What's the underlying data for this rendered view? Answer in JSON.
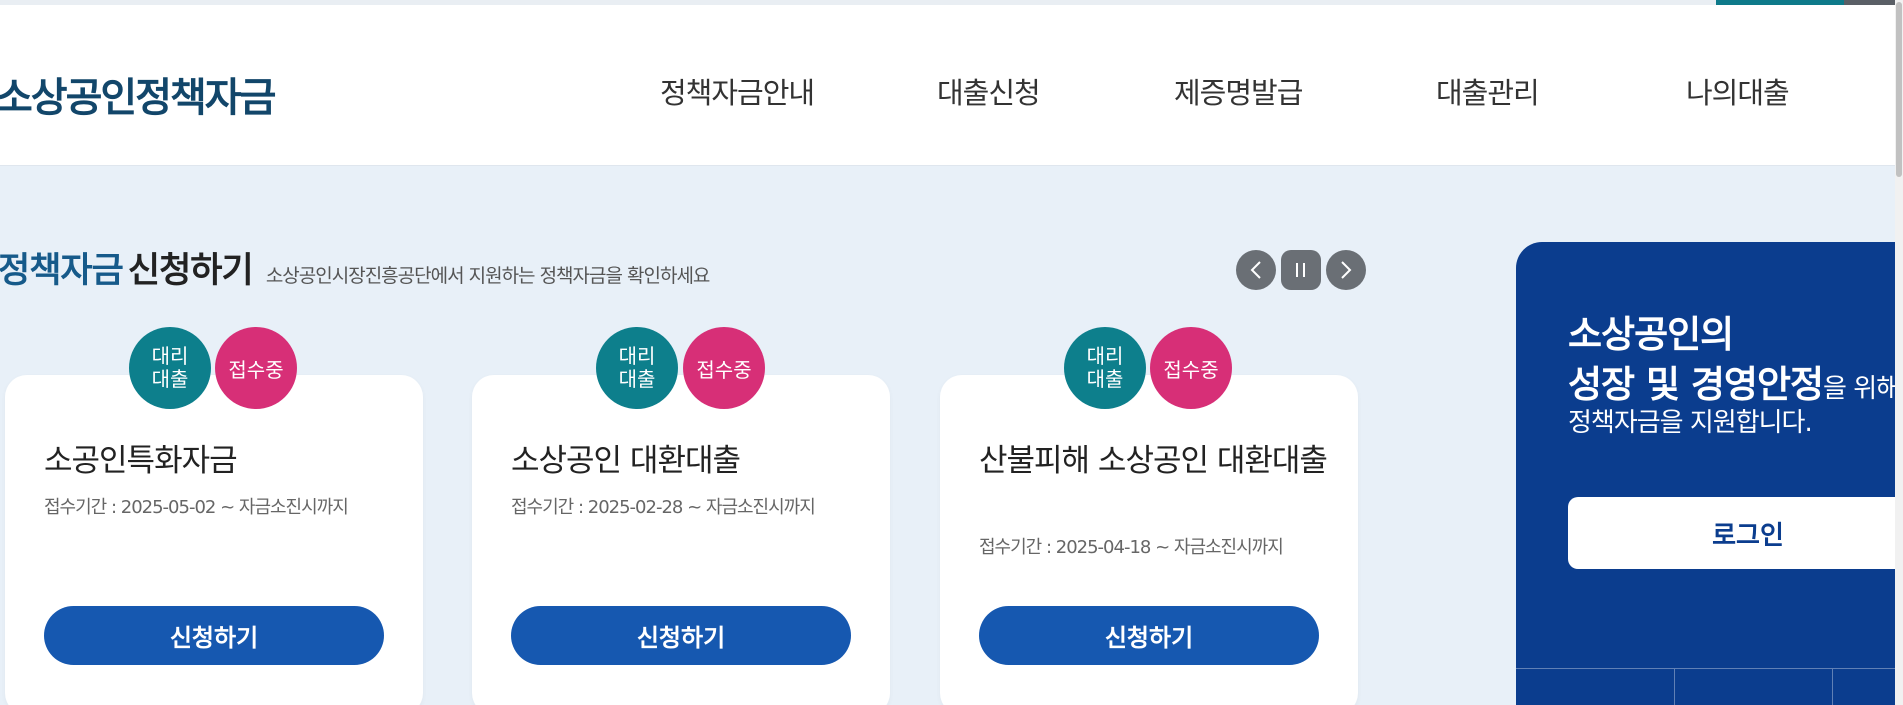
{
  "header": {
    "logo": "소상공인정책자금",
    "nav": [
      "정책자금안내",
      "대출신청",
      "제증명발급",
      "대출관리",
      "나의대출"
    ]
  },
  "section": {
    "title_highlight": "정책자금",
    "title_rest": "신청하기",
    "subtitle": "소상공인시장진흥공단에서 지원하는 정책자금을 확인하세요"
  },
  "slider": {
    "prev_icon": "chevron-left-icon",
    "pause_icon": "pause-icon",
    "next_icon": "chevron-right-icon"
  },
  "badges": {
    "agent": "대리\n대출",
    "status": "접수중"
  },
  "cards": [
    {
      "title": "소공인특화자금",
      "period": "접수기간 : 2025-05-02 ~ 자금소진시까지",
      "button": "신청하기"
    },
    {
      "title": "소상공인 대환대출",
      "period": "접수기간 : 2025-02-28 ~ 자금소진시까지",
      "button": "신청하기"
    },
    {
      "title": "산불피해 소상공인 대환대출",
      "period": "접수기간 : 2025-04-18 ~ 자금소진시까지",
      "button": "신청하기"
    }
  ],
  "side_panel": {
    "line1": "소상공인의",
    "line2_bold": "성장 및 경영안정",
    "line2_rest": "을 위해",
    "line3": "정책자금을 지원합니다.",
    "login_button": "로그인"
  },
  "colors": {
    "brand_navy": "#12466a",
    "teal_badge": "#0d7f8c",
    "pink_badge": "#d72f77",
    "button_blue": "#1658b0",
    "panel_blue": "#0b3d8e",
    "page_bg": "#e8f0f8"
  }
}
